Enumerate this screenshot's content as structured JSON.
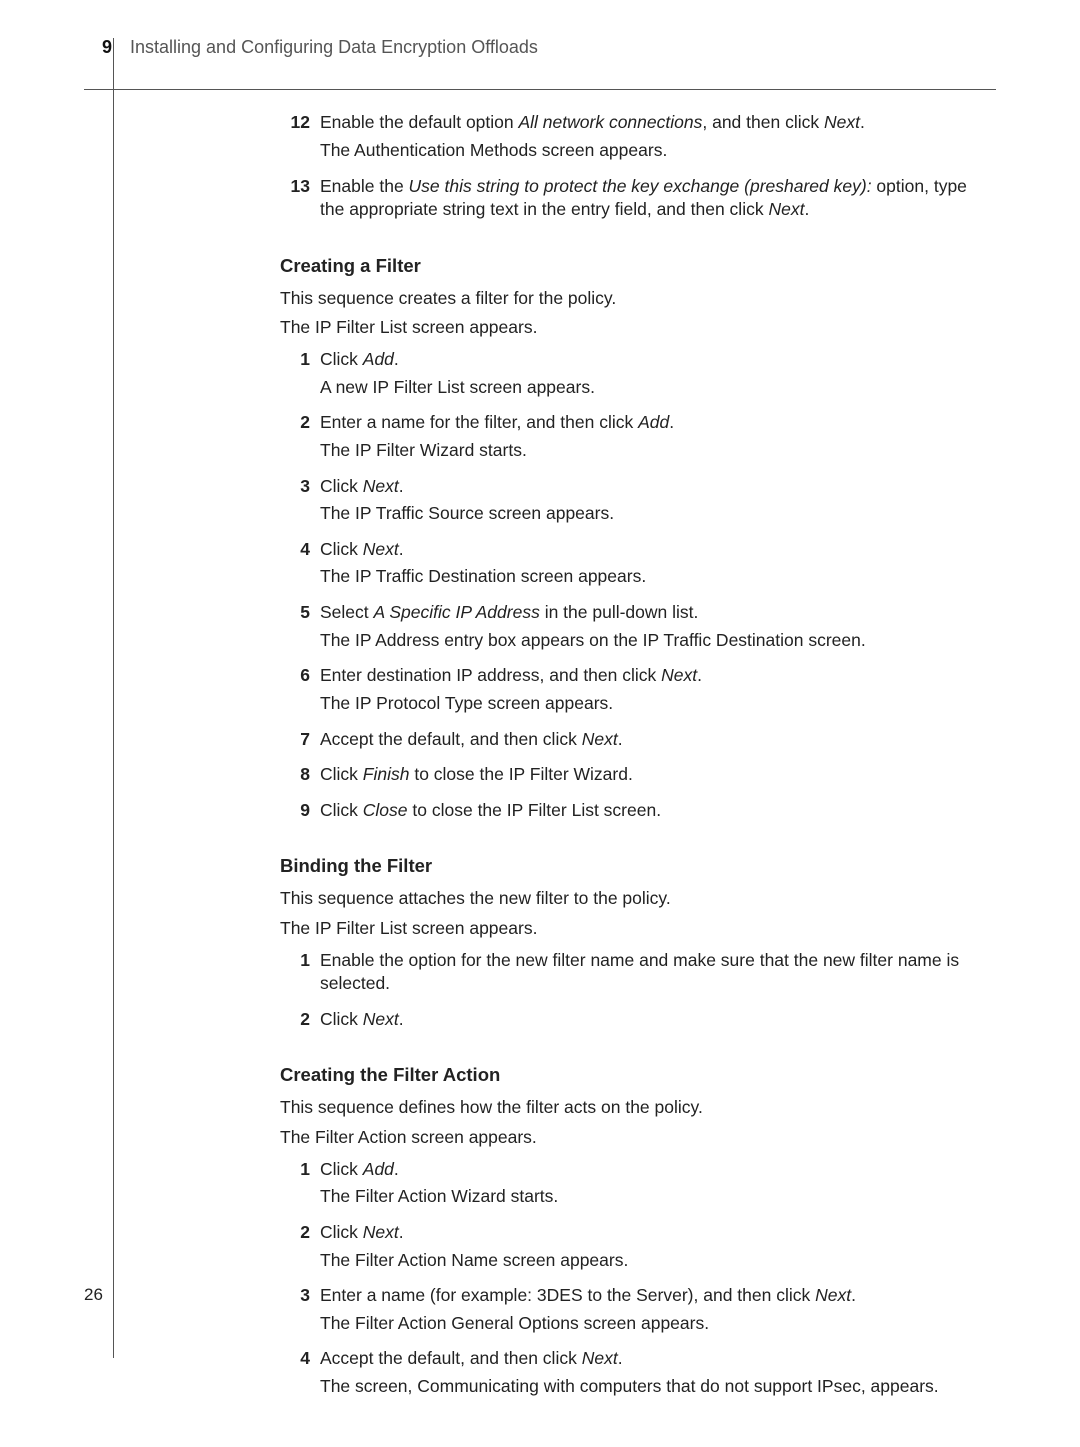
{
  "header": {
    "chapter_number": "9",
    "chapter_title": "Installing and Configuring Data Encryption Offloads"
  },
  "page_number": "26",
  "top_steps": {
    "s12": {
      "num": "12",
      "a1": "Enable the default option ",
      "a_em": "All network connections",
      "a2": ", and then click ",
      "a_em2": "Next",
      "a3": ".",
      "b": "The Authentication Methods screen appears."
    },
    "s13": {
      "num": "13",
      "a1": "Enable the ",
      "a_em": "Use this string to protect the key exchange (preshared key):",
      "a2": " option, type the appropriate string text in the entry field, and then click ",
      "a_em2": "Next",
      "a3": "."
    }
  },
  "sec1": {
    "heading": "Creating a Filter",
    "intro1": "This sequence creates a filter for the policy.",
    "intro2": "The IP Filter List screen appears.",
    "s1": {
      "num": "1",
      "a1": "Click ",
      "a_em": "Add",
      "a2": ".",
      "b": "A new IP Filter List screen appears."
    },
    "s2": {
      "num": "2",
      "a1": "Enter a name for the filter, and then click ",
      "a_em": "Add",
      "a2": ".",
      "b": "The IP Filter Wizard starts."
    },
    "s3": {
      "num": "3",
      "a1": "Click ",
      "a_em": "Next",
      "a2": ".",
      "b": "The IP Traffic Source screen appears."
    },
    "s4": {
      "num": "4",
      "a1": "Click ",
      "a_em": "Next",
      "a2": ".",
      "b": "The IP Traffic Destination screen appears."
    },
    "s5": {
      "num": "5",
      "a1": "Select ",
      "a_em": "A Specific IP Address",
      "a2": " in the pull-down list.",
      "b": "The IP Address entry box appears on the IP Traffic Destination screen."
    },
    "s6": {
      "num": "6",
      "a1": "Enter destination IP address, and then click ",
      "a_em": "Next",
      "a2": ".",
      "b": "The IP Protocol Type screen appears."
    },
    "s7": {
      "num": "7",
      "a1": "Accept the default, and then click ",
      "a_em": "Next",
      "a2": "."
    },
    "s8": {
      "num": "8",
      "a1": "Click ",
      "a_em": "Finish",
      "a2": " to close the IP Filter Wizard."
    },
    "s9": {
      "num": "9",
      "a1": "Click ",
      "a_em": "Close",
      "a2": " to close the IP Filter List screen."
    }
  },
  "sec2": {
    "heading": "Binding the Filter",
    "intro1": "This sequence attaches the new filter to the policy.",
    "intro2": "The IP Filter List screen appears.",
    "s1": {
      "num": "1",
      "a": "Enable the option for the new filter name and make sure that the new filter name is selected."
    },
    "s2": {
      "num": "2",
      "a1": "Click ",
      "a_em": "Next",
      "a2": "."
    }
  },
  "sec3": {
    "heading": "Creating the Filter Action",
    "intro1": "This sequence defines how the filter acts on the policy.",
    "intro2": "The Filter Action screen appears.",
    "s1": {
      "num": "1",
      "a1": "Click ",
      "a_em": "Add",
      "a2": ".",
      "b": "The Filter Action Wizard starts."
    },
    "s2": {
      "num": "2",
      "a1": "Click ",
      "a_em": "Next",
      "a2": ".",
      "b": "The Filter Action Name screen appears."
    },
    "s3": {
      "num": "3",
      "a1": "Enter a name (for example: 3DES to the Server), and then click ",
      "a_em": "Next",
      "a2": ".",
      "b": "The Filter Action General Options screen appears."
    },
    "s4": {
      "num": "4",
      "a1": "Accept the default, and then click ",
      "a_em": "Next",
      "a2": ".",
      "b": "The screen, Communicating with computers that do not support IPsec, appears."
    }
  }
}
